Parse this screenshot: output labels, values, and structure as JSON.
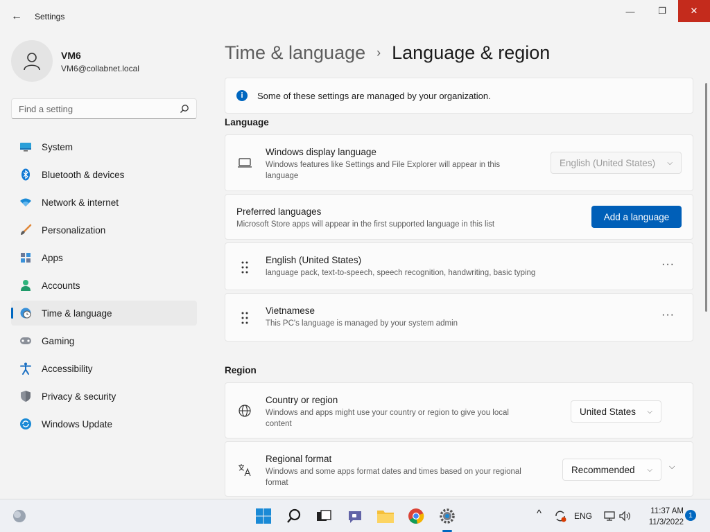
{
  "window": {
    "title": "Settings",
    "back_glyph": "←",
    "minimize_glyph": "—",
    "maximize_glyph": "❐",
    "close_glyph": "✕"
  },
  "user": {
    "name": "VM6",
    "email": "VM6@collabnet.local"
  },
  "search": {
    "placeholder": "Find a setting"
  },
  "nav": {
    "items": [
      {
        "label": "System",
        "icon": "system-icon"
      },
      {
        "label": "Bluetooth & devices",
        "icon": "bluetooth-icon"
      },
      {
        "label": "Network & internet",
        "icon": "wifi-icon"
      },
      {
        "label": "Personalization",
        "icon": "brush-icon"
      },
      {
        "label": "Apps",
        "icon": "apps-icon"
      },
      {
        "label": "Accounts",
        "icon": "accounts-icon"
      },
      {
        "label": "Time & language",
        "icon": "globe-clock-icon",
        "active": true
      },
      {
        "label": "Gaming",
        "icon": "gamepad-icon"
      },
      {
        "label": "Accessibility",
        "icon": "accessibility-icon"
      },
      {
        "label": "Privacy & security",
        "icon": "shield-icon"
      },
      {
        "label": "Windows Update",
        "icon": "update-icon"
      }
    ]
  },
  "breadcrumb": {
    "parent": "Time & language",
    "separator": "›",
    "current": "Language & region"
  },
  "info": {
    "icon_glyph": "i",
    "text": "Some of these settings are managed by your organization."
  },
  "language": {
    "section_title": "Language",
    "display_language": {
      "title": "Windows display language",
      "description": "Windows features like Settings and File Explorer will appear in this language",
      "value": "English (United States)"
    },
    "preferred": {
      "title": "Preferred languages",
      "description": "Microsoft Store apps will appear in the first supported language in this list",
      "button": "Add a language"
    },
    "languages": [
      {
        "name": "English (United States)",
        "detail": "language pack, text-to-speech, speech recognition, handwriting, basic typing",
        "more": "···"
      },
      {
        "name": "Vietnamese",
        "detail": "This PC's language is managed by your system admin",
        "more": "···"
      }
    ]
  },
  "region": {
    "section_title": "Region",
    "country": {
      "title": "Country or region",
      "description": "Windows and apps might use your country or region to give you local content",
      "value": "United States"
    },
    "format": {
      "title": "Regional format",
      "description": "Windows and some apps format dates and times based on your regional format",
      "value": "Recommended"
    }
  },
  "taskbar": {
    "tray_lang": "ENG",
    "time": "11:37 AM",
    "date": "11/3/2022",
    "notifications": "1",
    "chevron_up": "^"
  },
  "colors": {
    "accent": "#0067c0",
    "button": "#005fb8",
    "close": "#c42b1c"
  }
}
